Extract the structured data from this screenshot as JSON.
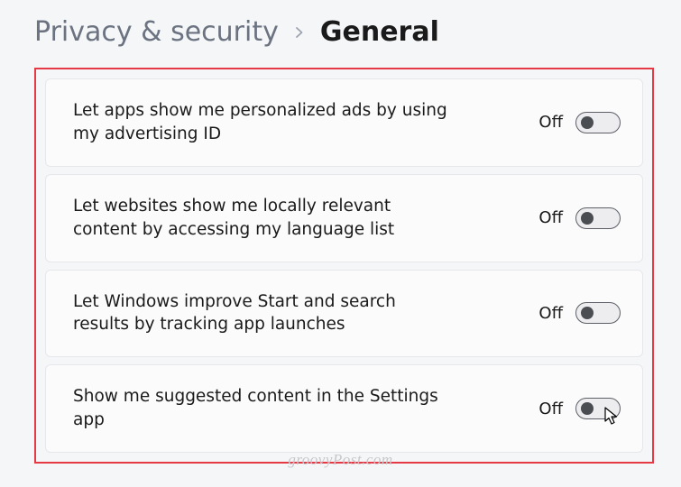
{
  "breadcrumb": {
    "parent": "Privacy & security",
    "current": "General"
  },
  "settings": [
    {
      "label": "Let apps show me personalized ads by using my advertising ID",
      "state": "Off"
    },
    {
      "label": "Let websites show me locally relevant content by accessing my language list",
      "state": "Off"
    },
    {
      "label": "Let Windows improve Start and search results by tracking app launches",
      "state": "Off"
    },
    {
      "label": "Show me suggested content in the Settings app",
      "state": "Off"
    }
  ],
  "watermark": "groovyPost.com"
}
